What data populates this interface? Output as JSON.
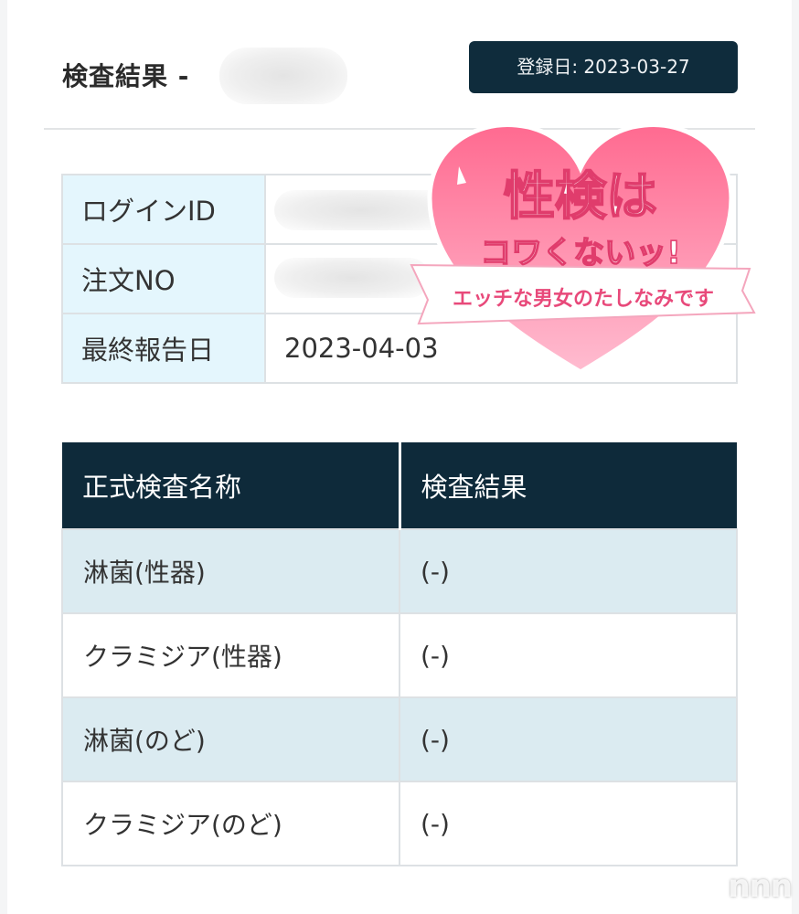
{
  "header": {
    "title": "検査結果 -",
    "registration_date": "登録日: 2023-03-27"
  },
  "info_table": {
    "rows": [
      {
        "label": "ログインID",
        "value": ""
      },
      {
        "label": "注文NO",
        "value": ""
      },
      {
        "label": "最終報告日",
        "value": "2023-04-03"
      }
    ]
  },
  "results_table": {
    "headers": [
      "正式検査名称",
      "検査結果"
    ],
    "rows": [
      {
        "name": "淋菌(性器)",
        "result": "(-)"
      },
      {
        "name": "クラミジア(性器)",
        "result": "(-)"
      },
      {
        "name": "淋菌(のど)",
        "result": "(-)"
      },
      {
        "name": "クラミジア(のど)",
        "result": "(-)"
      }
    ]
  },
  "sticker": {
    "line1": "性検は",
    "line2": "コワくないッ!",
    "ribbon": "エッチな男女のたしなみです",
    "colors": {
      "heart_top": "#ff6f93",
      "heart_bottom": "#ffb3c8",
      "ribbon": "#ffffff",
      "ribbon_text": "#e8497a"
    }
  },
  "watermark": "nnn"
}
